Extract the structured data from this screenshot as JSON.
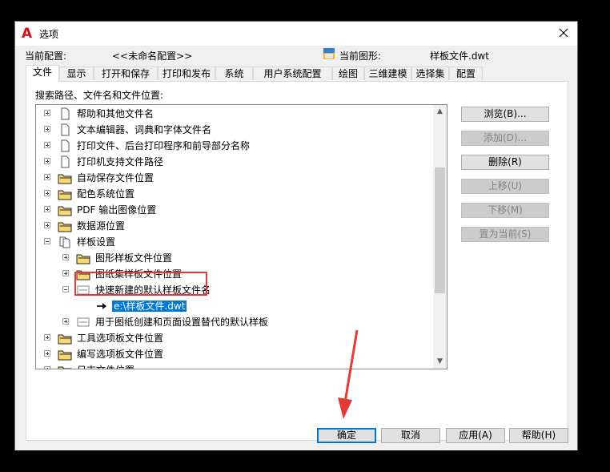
{
  "window": {
    "title": "选项"
  },
  "profile": {
    "label": "当前配置:",
    "value": "<<未命名配置>>",
    "drawing_label": "当前图形:",
    "drawing_value": "样板文件.dwt"
  },
  "tabs": [
    {
      "label": "文件",
      "active": true
    },
    {
      "label": "显示"
    },
    {
      "label": "打开和保存"
    },
    {
      "label": "打印和发布"
    },
    {
      "label": "系统"
    },
    {
      "label": "用户系统配置"
    },
    {
      "label": "绘图"
    },
    {
      "label": "三维建模"
    },
    {
      "label": "选择集"
    },
    {
      "label": "配置"
    }
  ],
  "search_label": "搜索路径、文件名和文件位置:",
  "tree": {
    "items": [
      {
        "label": "帮助和其他文件名",
        "icon": "document-icon"
      },
      {
        "label": "文本编辑器、词典和字体文件名",
        "icon": "document-icon"
      },
      {
        "label": "打印文件、后台打印程序和前导部分名称",
        "icon": "document-icon"
      },
      {
        "label": "打印机支持文件路径",
        "icon": "document-icon"
      },
      {
        "label": "自动保存文件位置",
        "icon": "folder-icon"
      },
      {
        "label": "配色系统位置",
        "icon": "folder-icon"
      },
      {
        "label": "PDF 输出图像位置",
        "icon": "folder-icon"
      },
      {
        "label": "数据源位置",
        "icon": "folder-icon"
      },
      {
        "label": "样板设置",
        "icon": "documents-icon"
      },
      {
        "label": "图形样板文件位置",
        "icon": "folder-icon"
      },
      {
        "label": "图纸集样板文件位置",
        "icon": "folder-icon"
      },
      {
        "label": "快速新建的默认样板文件名",
        "icon": "dwg-icon"
      },
      {
        "label": "e:\\样板文件.dwt",
        "icon": "arrow-icon"
      },
      {
        "label": "用于图纸创建和页面设置替代的默认样板",
        "icon": "dwg-icon"
      },
      {
        "label": "工具选项板文件位置",
        "icon": "folder-icon"
      },
      {
        "label": "编写选项板文件位置",
        "icon": "folder-icon"
      },
      {
        "label": "日志文件位置",
        "icon": "folder-icon"
      }
    ]
  },
  "side_buttons": {
    "browse": "浏览(B)...",
    "add": "添加(D)...",
    "delete": "删除(R)",
    "move_up": "上移(U)",
    "move_down": "下移(M)",
    "set_current": "置为当前(S)"
  },
  "bottom_buttons": {
    "ok": "确定",
    "cancel": "取消",
    "apply": "应用(A)",
    "help": "帮助(H)"
  },
  "colors": {
    "accent": "#0078d7",
    "annotation": "#e53935",
    "app_icon": "#d20f14"
  }
}
